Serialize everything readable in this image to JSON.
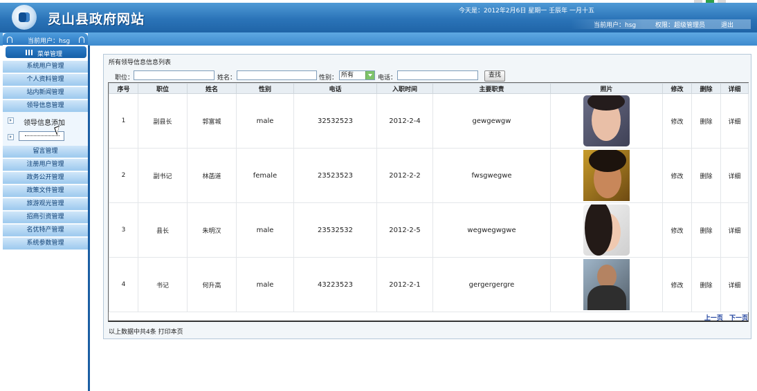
{
  "header": {
    "site_title": "灵山县政府网站",
    "date_line": "今天是：2012年2月6日  星期一  壬辰年  一月十五",
    "current_user_label": "当前用户：hsg",
    "role_label": "权限：超级管理员",
    "logout_label": "退出"
  },
  "sidebar": {
    "user_label": "当前用户：hsg",
    "menu_header": "菜单管理",
    "items_top": [
      "系统用户管理",
      "个人资料管理",
      "站内新闻管理",
      "领导信息管理"
    ],
    "sub_link": "领导信息添加",
    "items_bottom": [
      "留言管理",
      "注册用户管理",
      "政务公开管理",
      "政策文件管理",
      "旅游观光管理",
      "招商引资管理",
      "名优特产管理",
      "系统参数管理"
    ]
  },
  "panel": {
    "title": "所有领导信息信息列表",
    "search": {
      "position_label": "职位：",
      "position_value": "",
      "name_label": "姓名：",
      "name_value": "",
      "gender_label": "性别：",
      "gender_selected": "所有",
      "phone_label": "电话：",
      "phone_value": "",
      "search_button": "查找"
    },
    "columns": [
      "序号",
      "职位",
      "姓名",
      "性别",
      "电话",
      "入职时间",
      "主要职责",
      "照片",
      "修改",
      "删除",
      "详细"
    ],
    "rows": [
      {
        "no": "1",
        "position": "副县长",
        "name": "郭富城",
        "gender": "male",
        "phone": "32532523",
        "date": "2012-2-4",
        "duty": "gewgewgw",
        "edit": "修改",
        "delete": "删除",
        "detail": "详细"
      },
      {
        "no": "2",
        "position": "副书记",
        "name": "林菡道",
        "gender": "female",
        "phone": "23523523",
        "date": "2012-2-2",
        "duty": "fwsgwegwe",
        "edit": "修改",
        "delete": "删除",
        "detail": "详细"
      },
      {
        "no": "3",
        "position": "县长",
        "name": "朱明汉",
        "gender": "male",
        "phone": "23532532",
        "date": "2012-2-5",
        "duty": "wegwegwgwe",
        "edit": "修改",
        "delete": "删除",
        "detail": "详细"
      },
      {
        "no": "4",
        "position": "书记",
        "name": "何升高",
        "gender": "male",
        "phone": "43223523",
        "date": "2012-2-1",
        "duty": "gergergergre",
        "edit": "修改",
        "delete": "删除",
        "detail": "详细"
      }
    ],
    "pager": {
      "prev": "上一页",
      "next": "下一页"
    },
    "footer_text": "以上数据中共4条  打印本页"
  },
  "colors": {
    "header_blue": "#2b74b8",
    "menu_item": "#b3d6f3",
    "divider": "#1b5ea3",
    "pager_link": "#1b3e9c"
  }
}
